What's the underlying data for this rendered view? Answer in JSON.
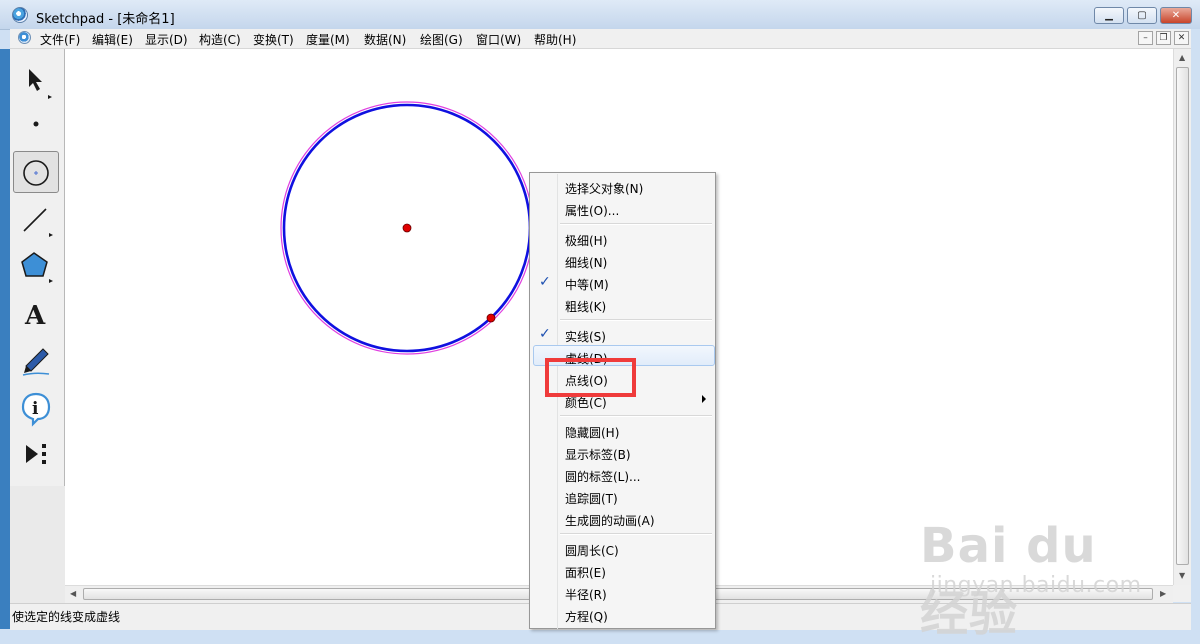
{
  "window": {
    "title": "Sketchpad  - [未命名1]",
    "controls": {
      "minimize": "▁",
      "maximize": "▢",
      "close": "✕"
    },
    "mdi_controls": {
      "minimize": "–",
      "restore": "❐",
      "close": "✕"
    }
  },
  "menubar": {
    "items": [
      {
        "label": "文件(F)"
      },
      {
        "label": "编辑(E)"
      },
      {
        "label": "显示(D)"
      },
      {
        "label": "构造(C)"
      },
      {
        "label": "变换(T)"
      },
      {
        "label": "度量(M)"
      },
      {
        "label": "数据(N)"
      },
      {
        "label": "绘图(G)"
      },
      {
        "label": "窗口(W)"
      },
      {
        "label": "帮助(H)"
      }
    ]
  },
  "toolbox": {
    "tools": [
      {
        "name": "arrow-select-icon"
      },
      {
        "name": "point-tool-icon"
      },
      {
        "name": "compass-circle-icon",
        "selected": true
      },
      {
        "name": "straightedge-icon"
      },
      {
        "name": "polygon-icon"
      },
      {
        "name": "text-tool-icon",
        "glyph": "A"
      },
      {
        "name": "marker-pen-icon"
      },
      {
        "name": "info-icon",
        "glyph": "i"
      },
      {
        "name": "custom-tool-icon"
      }
    ]
  },
  "canvas": {
    "colors": {
      "circle_stroke": "#1010e0",
      "circle_halo": "#e040e0",
      "points": "#e00000"
    }
  },
  "context_menu": {
    "groups": [
      [
        {
          "label": "选择父对象(N)"
        },
        {
          "label": "属性(O)..."
        }
      ],
      [
        {
          "label": "极细(H)"
        },
        {
          "label": "细线(N)"
        },
        {
          "label": "中等(M)",
          "checked": true
        },
        {
          "label": "粗线(K)"
        }
      ],
      [
        {
          "label": "实线(S)",
          "checked": true
        },
        {
          "label": "虚线(D)",
          "hovered": true
        },
        {
          "label": "点线(O)",
          "boxed": true
        },
        {
          "label": "颜色(C)",
          "submenu": true
        }
      ],
      [
        {
          "label": "隐藏圆(H)"
        },
        {
          "label": "显示标签(B)"
        },
        {
          "label": "圆的标签(L)..."
        },
        {
          "label": "追踪圆(T)"
        },
        {
          "label": "生成圆的动画(A)"
        }
      ],
      [
        {
          "label": "圆周长(C)"
        },
        {
          "label": "面积(E)"
        },
        {
          "label": "半径(R)"
        },
        {
          "label": "方程(Q)"
        }
      ]
    ],
    "check_glyph": "✓",
    "highlight_color": "#ef3b3b"
  },
  "statusbar": {
    "text": "使选定的线变成虚线"
  },
  "watermark": {
    "brand": "Bai du 经验",
    "url": "jingyan.baidu.com"
  }
}
